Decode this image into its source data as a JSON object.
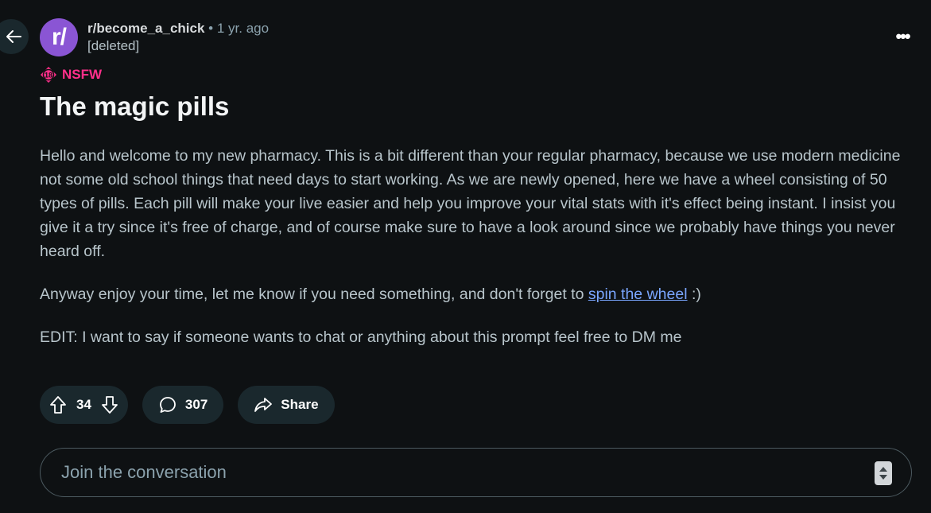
{
  "post": {
    "subreddit": "r/become_a_chick",
    "separator": "•",
    "age": "1 yr. ago",
    "author": "[deleted]",
    "avatar_text": "r/",
    "nsfw_badge": "18",
    "nsfw_label": "NSFW",
    "title": "The magic pills",
    "body_paragraph_1": "Hello and welcome to my new pharmacy. This is a bit different than your regular pharmacy, because we use modern medicine not some old school things that need days to start working. As we are newly opened, here we have a wheel consisting of 50 types of pills. Each pill will make your live easier and help you improve your vital stats with it's effect being instant. I insist you give it a try since it's free of charge, and of course make sure to have a look around since we probably have things you never heard off.",
    "body_paragraph_2_before": "Anyway enjoy your time, let me know if you need something, and don't forget to ",
    "body_paragraph_2_link": "spin the wheel",
    "body_paragraph_2_after": " :)",
    "body_paragraph_3": "EDIT: I want to say if someone wants to chat or anything about this prompt feel free to DM me"
  },
  "actions": {
    "votes": "34",
    "comments": "307",
    "share_label": "Share"
  },
  "comment_box": {
    "placeholder": "Join the conversation"
  },
  "colors": {
    "background": "#0e1113",
    "pill": "#1a282d",
    "avatar": "#8a55d4",
    "nsfw": "#ff2f8a",
    "link": "#7aa6ff"
  }
}
